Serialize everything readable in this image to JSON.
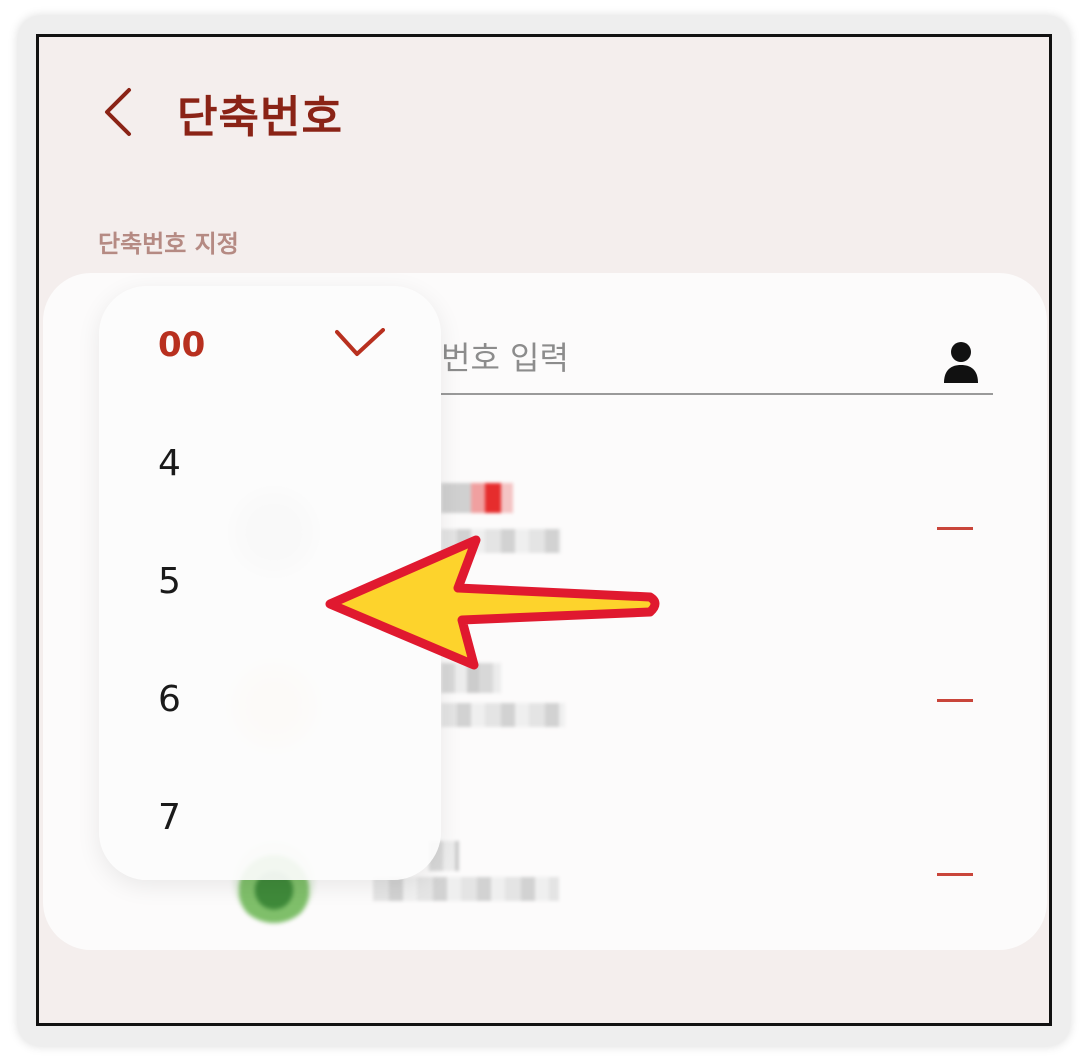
{
  "header": {
    "title": "단축번호"
  },
  "section": {
    "label": "단축번호 지정"
  },
  "number_input": {
    "placeholder": "번호 입력"
  },
  "dropdown": {
    "selected": "00",
    "options": [
      "00",
      "4",
      "5",
      "6",
      "7"
    ]
  },
  "colors": {
    "accent": "#b8301f",
    "title": "#8a2316",
    "section_label": "#b58a83",
    "background": "#f4eeed",
    "arrow_fill": "#fdd32c",
    "arrow_outline": "#e0192f"
  }
}
